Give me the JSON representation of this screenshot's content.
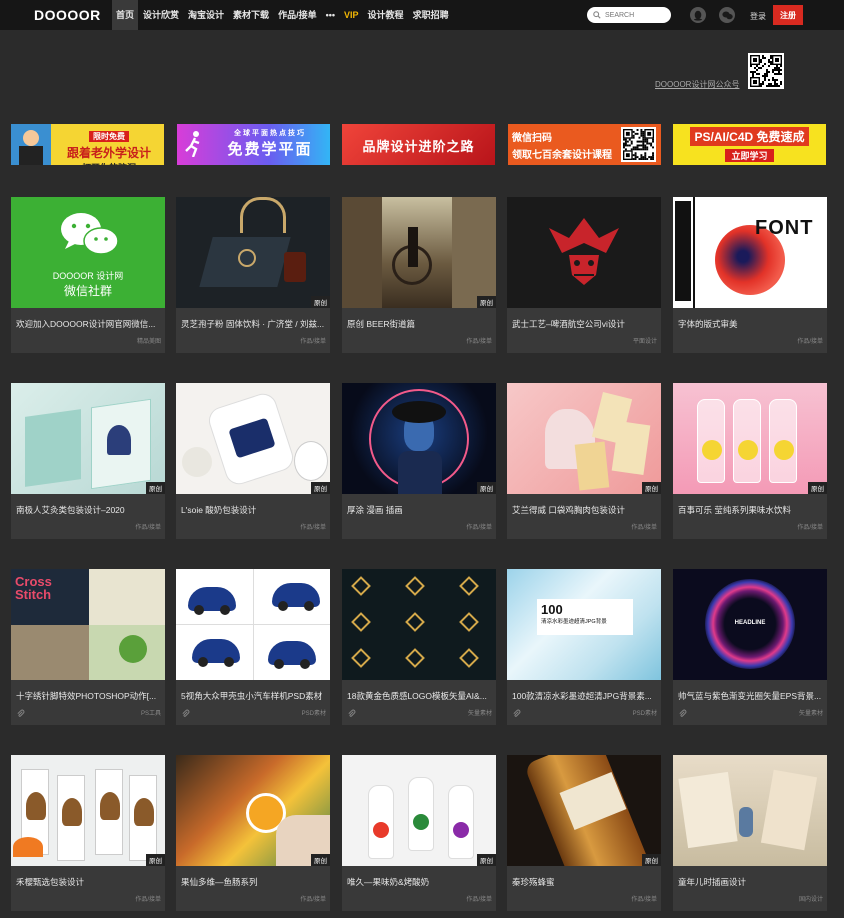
{
  "site": {
    "logo": "DOOOOR"
  },
  "nav": {
    "items": [
      {
        "label": "首页",
        "active": true
      },
      {
        "label": "设计欣赏"
      },
      {
        "label": "淘宝设计"
      },
      {
        "label": "素材下载"
      },
      {
        "label": "作品/接单"
      },
      {
        "label": "•••"
      },
      {
        "label": "VIP",
        "vip": true
      },
      {
        "label": "设计教程"
      },
      {
        "label": "求职招聘"
      }
    ]
  },
  "search": {
    "placeholder": "SEARCH"
  },
  "header": {
    "login": "登录",
    "register": "注册",
    "wechat_label": "DOOOOR设计网公众号"
  },
  "banners": [
    {
      "line1": "限时免费",
      "line2": "跟着老外学设计",
      "line3": "打开你的脑洞",
      "bg": "#f5d533",
      "fg": "#c8201b"
    },
    {
      "line1": "全球平面热点技巧",
      "line2": "免费学平面",
      "bg": "#b83de8",
      "fg": "#ffffff"
    },
    {
      "line1": "品牌设计进阶之路",
      "bg": "#e2261f",
      "fg": "#ffffff"
    },
    {
      "line1": "微信扫码",
      "line2": "领取七百余套设计课程",
      "bg": "#ea5a1f",
      "fg": "#ffffff"
    },
    {
      "line1": "PS/AI/C4D 免费速成",
      "line2": "立即学习",
      "bg": "#f7e21f",
      "fg": "#c8201b"
    }
  ],
  "cards": [
    {
      "title": "欢迎加入DOOOOR设计网官网微信...",
      "cat": "精品美图",
      "img": "wechat",
      "wx_line1": "DOOOOR 设计网",
      "wx_line2": "微信社群"
    },
    {
      "title": "灵芝孢子粉 固体饮料 · 广济堂 / 刘兹...",
      "cat": "作品/接单",
      "badge": "原创",
      "img": "dark-pack"
    },
    {
      "title": "原创 BEER街道篇",
      "cat": "作品/接单",
      "badge": "原创",
      "img": "beer"
    },
    {
      "title": "武士工艺–啤酒航空公司vi设计",
      "cat": "平面设计",
      "img": "samurai"
    },
    {
      "title": "字体的版式审美",
      "cat": "作品/接单",
      "img": "font",
      "img_text": "FONT"
    },
    {
      "title": "南极人艾灸类包装设计–2020",
      "cat": "作品/接单",
      "badge": "原创",
      "img": "mint-pack"
    },
    {
      "title": "L'soie 酸奶包装设计",
      "cat": "作品/接单",
      "badge": "原创",
      "img": "yogurt"
    },
    {
      "title": "厚涂 漫画 插画",
      "cat": "作品/接单",
      "badge": "原创",
      "img": "portrait"
    },
    {
      "title": "艾兰得威 口袋鸡胸肉包装设计",
      "cat": "作品/接单",
      "badge": "原创",
      "img": "chicken"
    },
    {
      "title": "百事可乐 莹纯系列果味水饮料",
      "cat": "作品/接单",
      "badge": "原创",
      "img": "pepsi"
    },
    {
      "title": "十字绣针脚特效PHOTOSHOP动作[...",
      "cat": "PS工具",
      "clip": true,
      "img": "stitch",
      "img_text": "Cross Stitch"
    },
    {
      "title": "5视角大众甲壳虫小汽车样机PSD素材",
      "cat": "PSD素材",
      "clip": true,
      "img": "beetle"
    },
    {
      "title": "18款黄金色质感LOGO模板矢量AI&...",
      "cat": "矢量素材",
      "clip": true,
      "img": "goldlogo"
    },
    {
      "title": "100款清凉水彩墨迹超清JPG背景素...",
      "cat": "PSD素材",
      "clip": true,
      "img": "watercolor",
      "wc_num": "100",
      "wc_text": "清凉水彩墨迹超清JPG背景"
    },
    {
      "title": "帅气蓝与紫色渐变光圈矢量EPS背景...",
      "cat": "矢量素材",
      "clip": true,
      "img": "ring",
      "img_text": "HEADLINE"
    },
    {
      "title": "禾樱甄选包装设计",
      "cat": "作品/接单",
      "badge": "原创",
      "img": "mushroom"
    },
    {
      "title": "果仙多维—鱼肠系列",
      "cat": "作品/接单",
      "badge": "原创",
      "img": "sausage"
    },
    {
      "title": "唯久—果味奶&烤酸奶",
      "cat": "作品/接单",
      "badge": "原创",
      "img": "milk"
    },
    {
      "title": "秦珍殇蜂蜜",
      "cat": "作品/接单",
      "badge": "原创",
      "img": "honey"
    },
    {
      "title": "童年儿时插画设计",
      "cat": "国内设计",
      "img": "childhood"
    }
  ]
}
